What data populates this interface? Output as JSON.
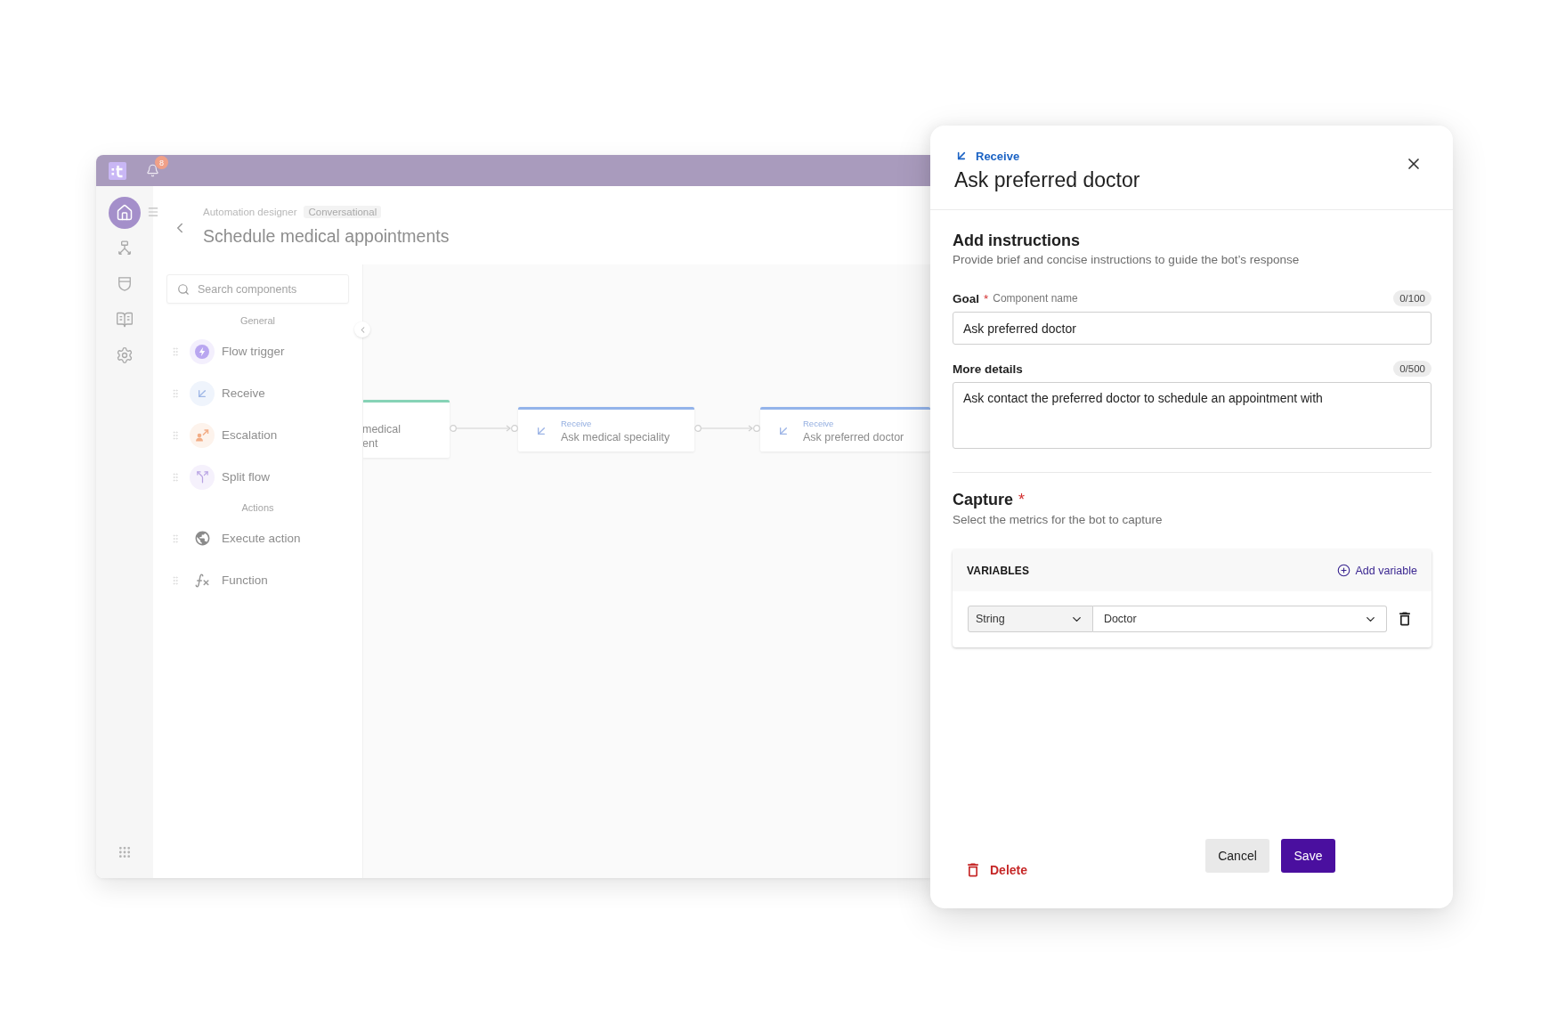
{
  "app": {
    "notifications": {
      "count": "8"
    },
    "nav_rail": [
      {
        "selected": true
      },
      {
        "selected": false
      },
      {
        "selected": false
      },
      {
        "selected": false
      },
      {
        "selected": false
      }
    ],
    "breadcrumb": [
      {
        "label": "Automation designer"
      },
      {
        "label": "Conversational"
      }
    ],
    "title": "Schedule medical appointments",
    "components": {
      "search": {
        "placeholder": "Search components"
      },
      "groups": [
        {
          "title": "General",
          "items": [
            {
              "kind": "trigger",
              "label": "Flow trigger"
            },
            {
              "kind": "receive",
              "label": "Receive"
            },
            {
              "kind": "escalation",
              "label": "Escalation"
            },
            {
              "kind": "split",
              "label": "Split flow"
            }
          ]
        },
        {
          "title": "Actions",
          "items": [
            {
              "kind": "action",
              "label": "Execute action"
            },
            {
              "kind": "function",
              "label": "Function"
            }
          ]
        }
      ]
    },
    "canvas": {
      "nodes": [
        {
          "kind": "partial",
          "color": "#86d3b6",
          "lines": [
            "medical",
            "ent"
          ]
        },
        {
          "kind": "receive",
          "color": "#93b3ea",
          "type": "Receive",
          "name": "Ask medical speciality"
        },
        {
          "kind": "receive",
          "color": "#93b3ea",
          "type": "Receive",
          "name": "Ask preferred doctor"
        }
      ]
    }
  },
  "panel": {
    "type": "Receive",
    "title": "Ask preferred doctor",
    "instructions": {
      "heading": "Add instructions",
      "description": "Provide brief and concise instructions to guide the bot’s response",
      "goal": {
        "label": "Goal",
        "required_mark": "*",
        "hint": "Component name",
        "counter": "0/100",
        "value": "Ask preferred doctor"
      },
      "details": {
        "label": "More details",
        "counter": "0/500",
        "value": "Ask contact the preferred doctor to schedule an appointment with"
      }
    },
    "capture": {
      "heading": "Capture",
      "required_mark": "*",
      "description": "Select the metrics for the bot to capture",
      "variables": {
        "title": "VARIABLES",
        "add_label": "Add variable",
        "rows": [
          {
            "type": "String",
            "name": "Doctor"
          }
        ]
      }
    },
    "delete_label": "Delete",
    "cancel_label": "Cancel",
    "save_label": "Save"
  }
}
